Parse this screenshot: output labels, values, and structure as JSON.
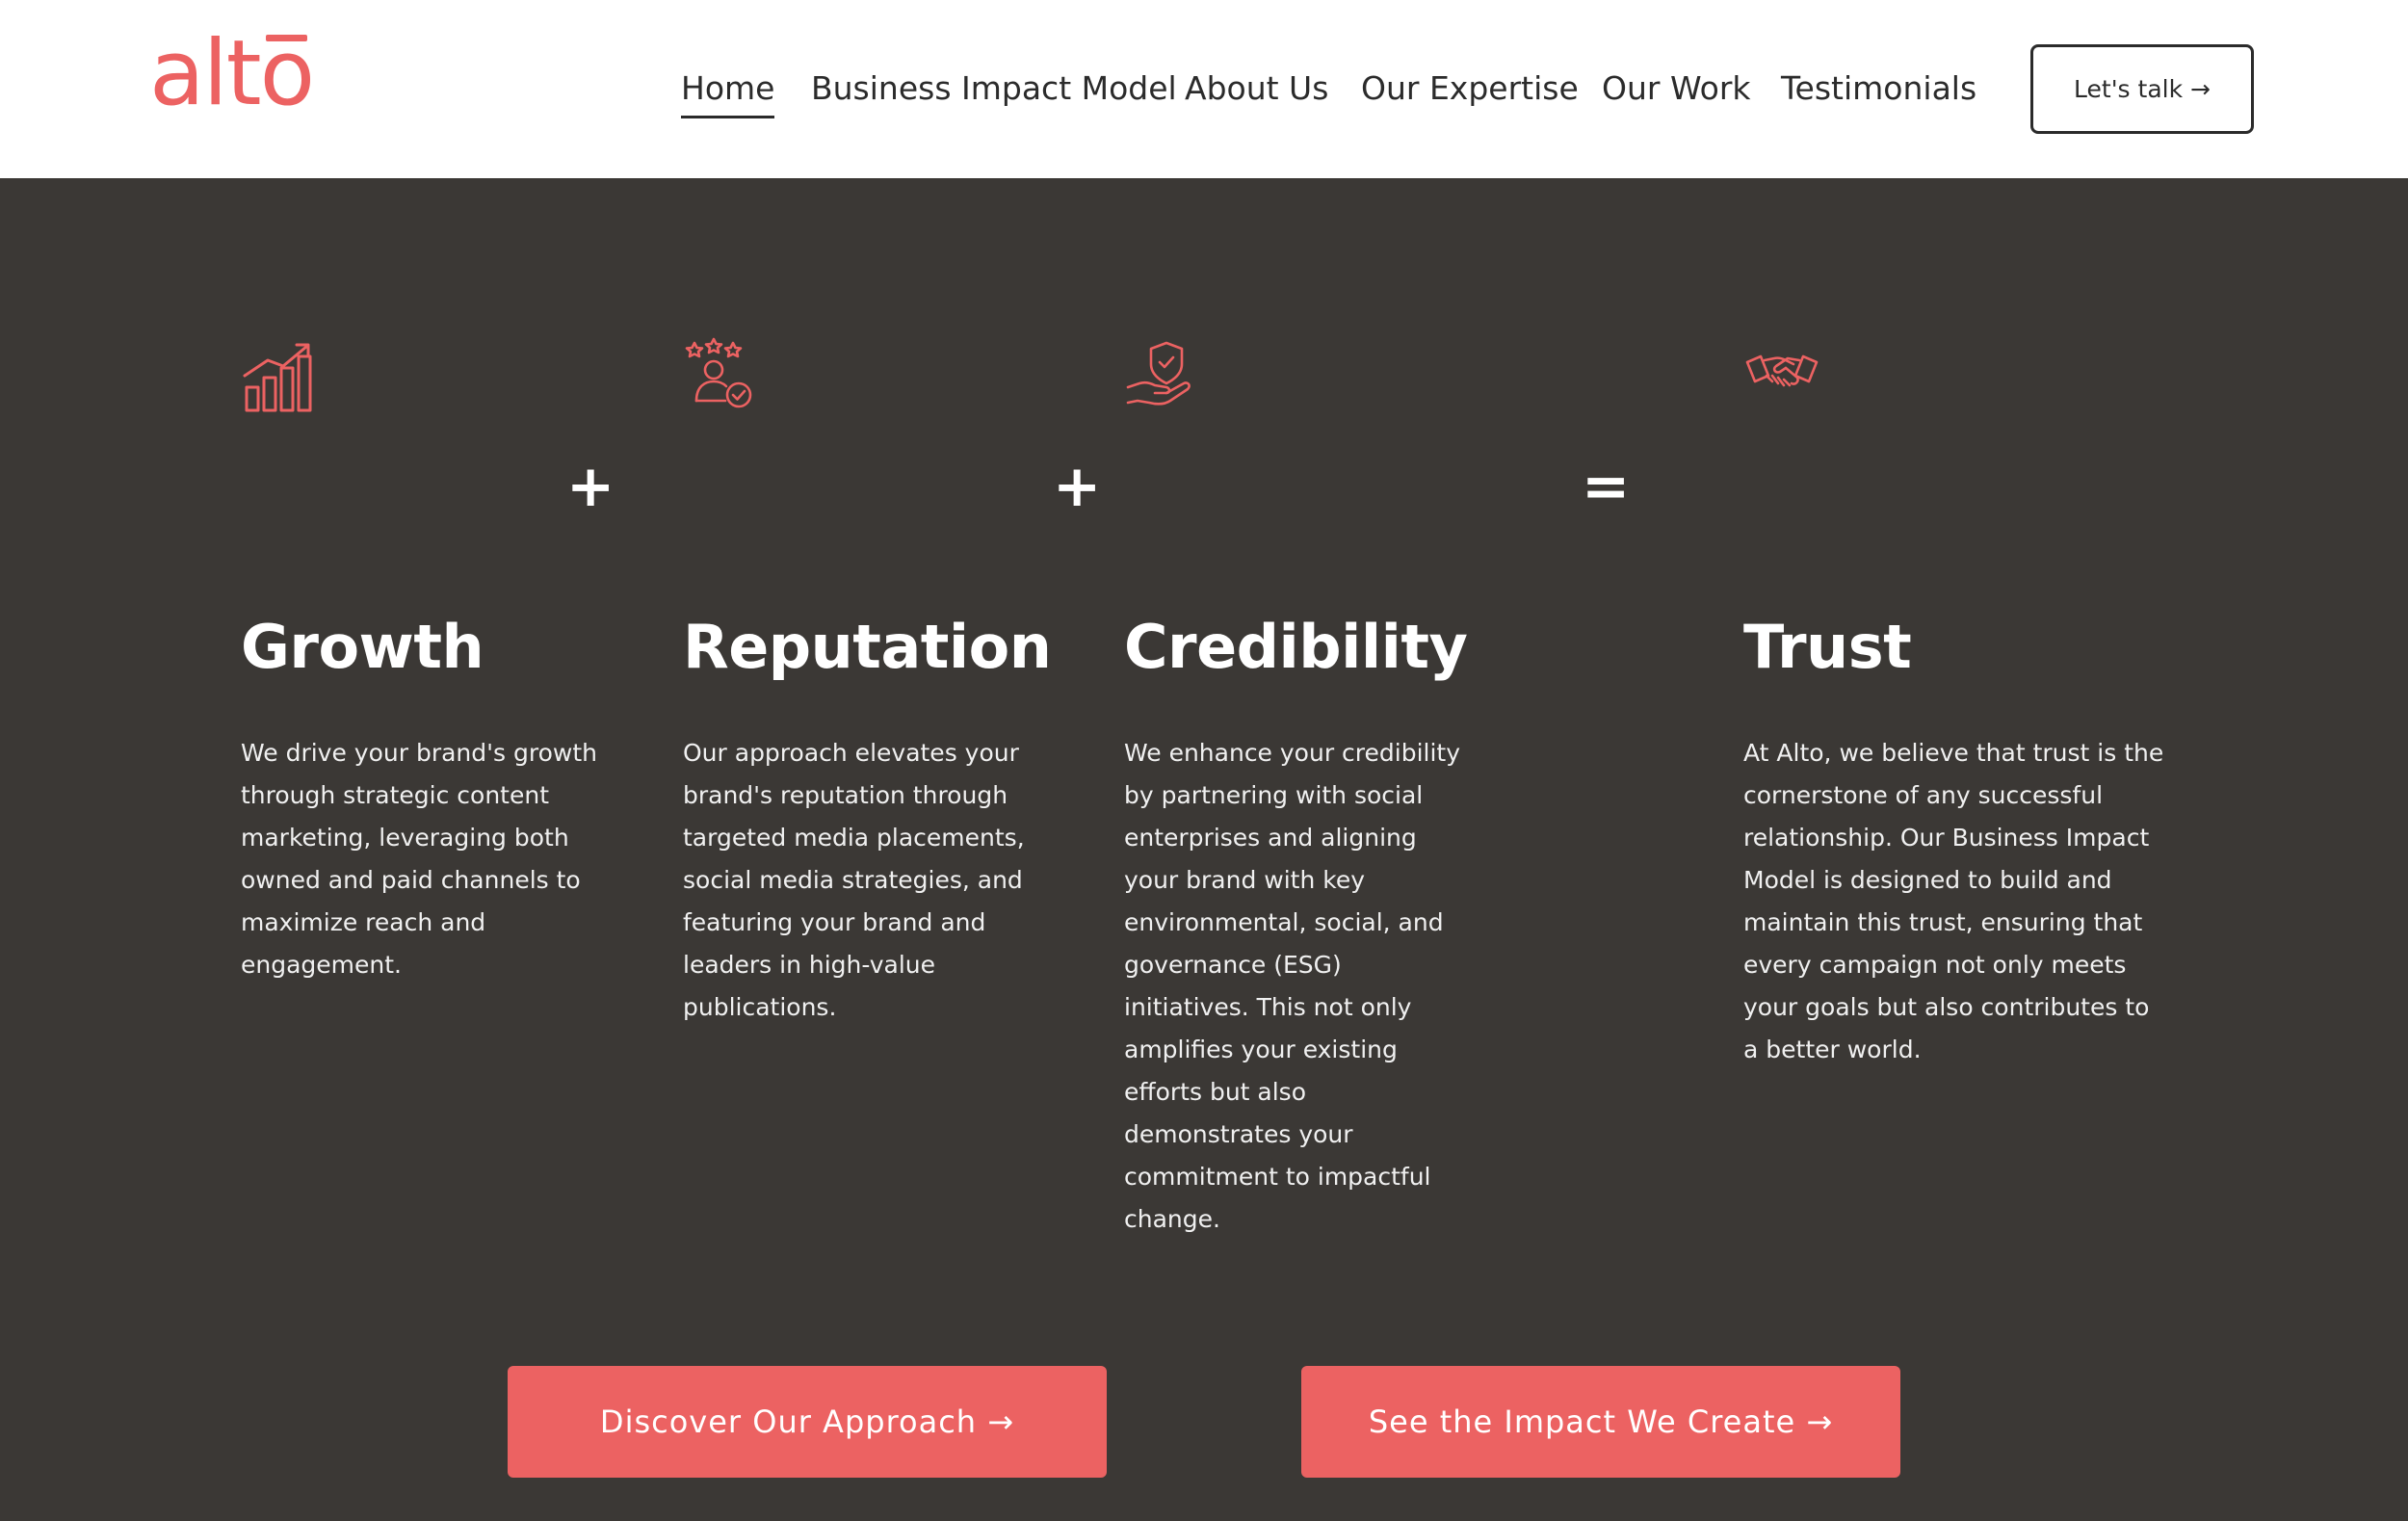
{
  "brand": {
    "logo_text": "alto",
    "accent": "#ec6262",
    "dark_bg": "#3b3835"
  },
  "nav": {
    "items": [
      {
        "label": "Home",
        "active": true
      },
      {
        "label": "Business Impact Model"
      },
      {
        "label": "About Us"
      },
      {
        "label": "Our Expertise"
      },
      {
        "label": "Our Work"
      },
      {
        "label": "Testimonials"
      }
    ],
    "cta_label": "Let's talk →"
  },
  "pillars": [
    {
      "icon": "growth-chart-icon",
      "title": "Growth",
      "text": "We drive your brand's growth through strategic content marketing, leveraging both owned and paid channels to maximize reach and engagement."
    },
    {
      "icon": "reputation-stars-person-icon",
      "title": "Reputation",
      "text": "Our approach elevates your brand's reputation through targeted media placements, social media strategies, and featuring your brand and leaders in high-value publications."
    },
    {
      "icon": "shield-hand-icon",
      "title": "Credibility",
      "text": "We enhance your credibility by partnering with social enterprises and aligning your brand with key environmental, social, and governance (ESG) initiatives. This not only amplifies your existing efforts but also demonstrates your commitment to impactful change."
    },
    {
      "icon": "handshake-icon",
      "title": "Trust",
      "text": "At Alto, we believe that trust is the cornerstone of any successful relationship. Our Business Impact Model is designed to build and maintain this trust, ensuring that every campaign not only meets your goals but also contributes to a better world."
    }
  ],
  "operators": [
    "+",
    "+",
    "="
  ],
  "buttons": {
    "approach": "Discover Our Approach →",
    "impact": "See the Impact We Create →"
  }
}
